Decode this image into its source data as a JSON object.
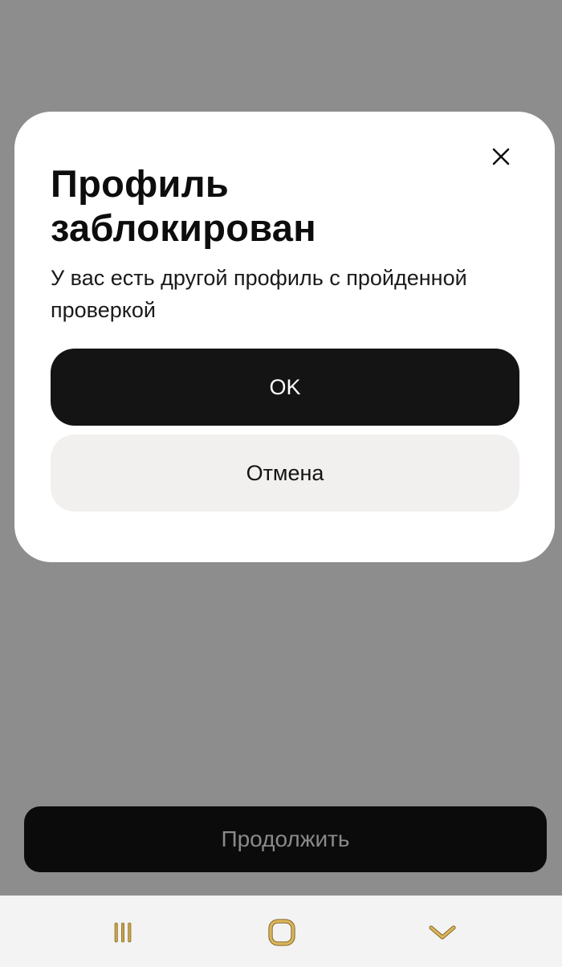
{
  "dialog": {
    "title": "Профиль заблокирован",
    "message": "У вас есть другой профиль с пройденной проверкой",
    "ok_label": "OK",
    "cancel_label": "Отмена",
    "close_icon": "close-icon"
  },
  "screen": {
    "continue_label": "Продолжить"
  },
  "navbar": {
    "icons": [
      "recents-icon",
      "home-icon",
      "back-icon"
    ]
  },
  "colors": {
    "overlay": "#8d8d8d",
    "dialog_bg": "#ffffff",
    "primary_button": "#141414",
    "secondary_button": "#f1f0ef",
    "nav_icon": "#c8a24a"
  }
}
